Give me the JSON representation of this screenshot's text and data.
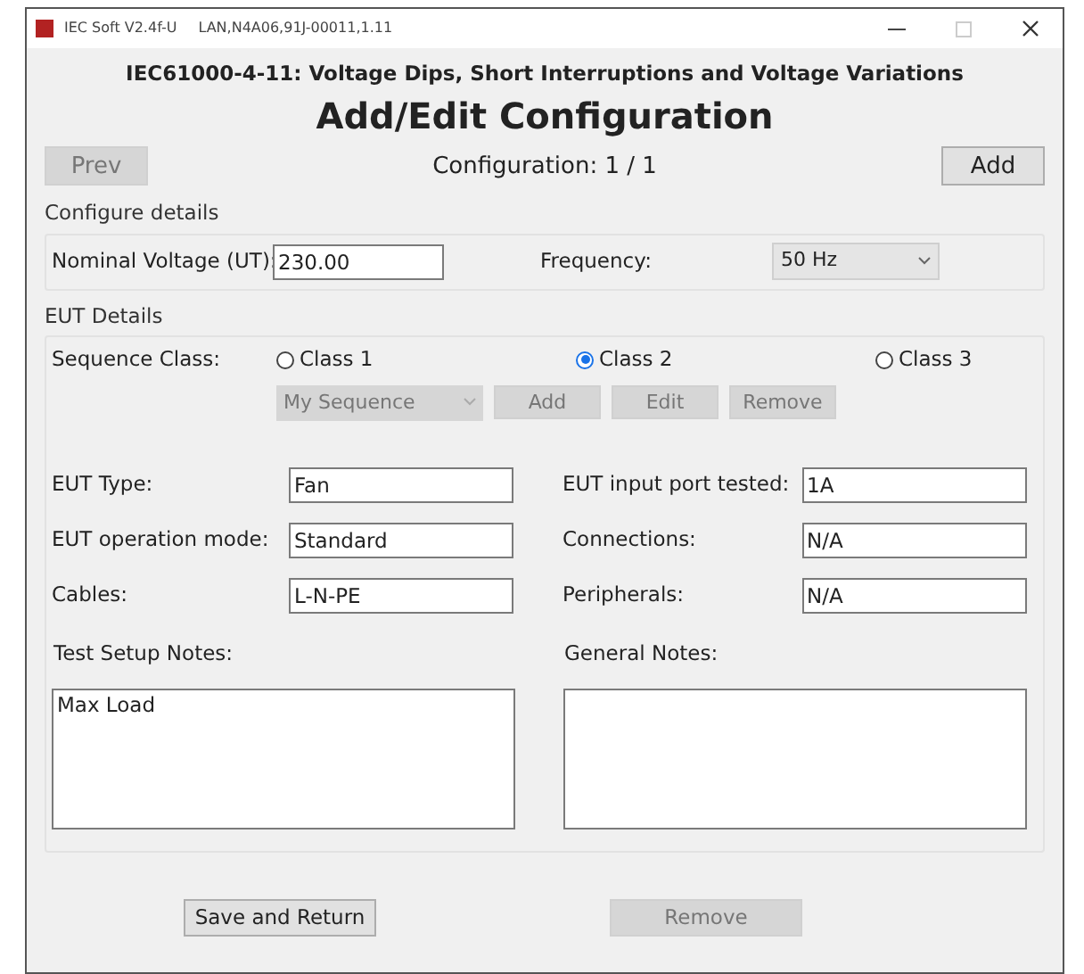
{
  "window": {
    "title": "IEC Soft V2.4f-U",
    "connection": "LAN,N4A06,91J-00011,1.11"
  },
  "heading": "IEC61000-4-11: Voltage Dips, Short Interruptions and Voltage Variations",
  "page_title": "Add/Edit Configuration",
  "nav": {
    "prev": {
      "label": "Prev",
      "disabled": true
    },
    "counter": "Configuration: 1 / 1",
    "add": {
      "label": "Add",
      "disabled": false
    }
  },
  "configure": {
    "title": "Configure details",
    "nominal_voltage": {
      "label": "Nominal Voltage (UT):",
      "value": "230.00"
    },
    "frequency": {
      "label": "Frequency:",
      "value": "50 Hz"
    }
  },
  "eut": {
    "title": "EUT Details",
    "sequence_class": {
      "label": "Sequence Class:",
      "options": [
        {
          "label": "Class 1",
          "selected": false
        },
        {
          "label": "Class 2",
          "selected": true
        },
        {
          "label": "Class 3",
          "selected": false
        }
      ],
      "dropdown": {
        "value": "My Sequence",
        "disabled": true
      },
      "buttons": [
        {
          "label": "Add",
          "disabled": true
        },
        {
          "label": "Edit",
          "disabled": true
        },
        {
          "label": "Remove",
          "disabled": true
        }
      ]
    },
    "fields": [
      {
        "label": "EUT Type:",
        "value": "Fan"
      },
      {
        "label": "EUT input port tested:",
        "value": "1A"
      },
      {
        "label": "EUT operation mode:",
        "value": "Standard"
      },
      {
        "label": "Connections:",
        "value": "N/A"
      },
      {
        "label": "Cables:",
        "value": "L-N-PE"
      },
      {
        "label": "Peripherals:",
        "value": "N/A"
      }
    ],
    "notes": [
      {
        "label": "Test Setup Notes:",
        "value": "Max Load"
      },
      {
        "label": "General Notes:"
      }
    ]
  },
  "footer_buttons": [
    {
      "label": "Save and Return",
      "disabled": false
    },
    {
      "label": "Remove",
      "disabled": true
    }
  ]
}
